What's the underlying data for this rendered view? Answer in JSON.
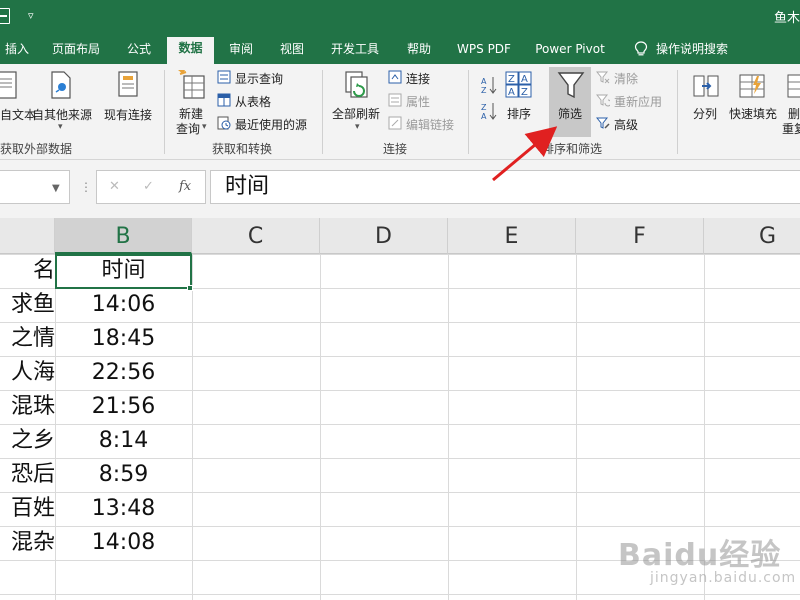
{
  "titlebar": {
    "dropdown_glyph": "▿",
    "user_label": "鱼木"
  },
  "tabs": [
    {
      "label": "插入",
      "active": false
    },
    {
      "label": "页面布局",
      "active": false
    },
    {
      "label": "公式",
      "active": false
    },
    {
      "label": "数据",
      "active": true
    },
    {
      "label": "审阅",
      "active": false
    },
    {
      "label": "视图",
      "active": false
    },
    {
      "label": "开发工具",
      "active": false
    },
    {
      "label": "帮助",
      "active": false
    },
    {
      "label": "WPS PDF",
      "active": false
    },
    {
      "label": "Power Pivot",
      "active": false
    }
  ],
  "tell_me": {
    "label": "操作说明搜索",
    "icon": "lightbulb-icon"
  },
  "ribbon": {
    "get_external": {
      "from_text": "自文本",
      "from_other": "自其他来源",
      "existing_conn": "现有连接",
      "group_label": "获取外部数据"
    },
    "get_transform": {
      "new_query": "新建",
      "new_query_2": "查询",
      "show_queries": "显示查询",
      "from_table": "从表格",
      "recent_sources": "最近使用的源",
      "group_label": "获取和转换"
    },
    "connections": {
      "refresh_all": "全部刷新",
      "connections": "连接",
      "properties": "属性",
      "edit_links": "编辑链接",
      "group_label": "连接"
    },
    "sort_filter": {
      "sort": "排序",
      "filter": "筛选",
      "clear": "清除",
      "reapply": "重新应用",
      "advanced": "高级",
      "group_label": "排序和筛选",
      "highlighted": "筛选"
    },
    "data_tools": {
      "text_to_columns": "分列",
      "flash_fill": "快速填充",
      "remove_dup_1": "删",
      "remove_dup_2": "重复"
    }
  },
  "formula_bar": {
    "name_box": "",
    "cancel_glyph": "✕",
    "enter_glyph": "✓",
    "fx_label": "fx",
    "formula": "时间"
  },
  "sheet": {
    "columns": [
      "B",
      "C",
      "D",
      "E",
      "F",
      "G"
    ],
    "selected_column": "B",
    "selected_cell": "B1",
    "rows": [
      {
        "a": "名",
        "b": "时间"
      },
      {
        "a": "求鱼",
        "b": "14:06"
      },
      {
        "a": "之情",
        "b": "18:45"
      },
      {
        "a": "人海",
        "b": "22:56"
      },
      {
        "a": "混珠",
        "b": "21:56"
      },
      {
        "a": "之乡",
        "b": "8:14"
      },
      {
        "a": "恐后",
        "b": "8:59"
      },
      {
        "a": "百姓",
        "b": "13:48"
      },
      {
        "a": "混杂",
        "b": "14:08"
      }
    ]
  },
  "colors": {
    "brand_green": "#217346",
    "arrow_red": "#e02020",
    "highlight_gray": "#c8c8c8"
  },
  "watermark": {
    "brand": "Baidu经验",
    "site": "jingyan.baidu.com"
  }
}
